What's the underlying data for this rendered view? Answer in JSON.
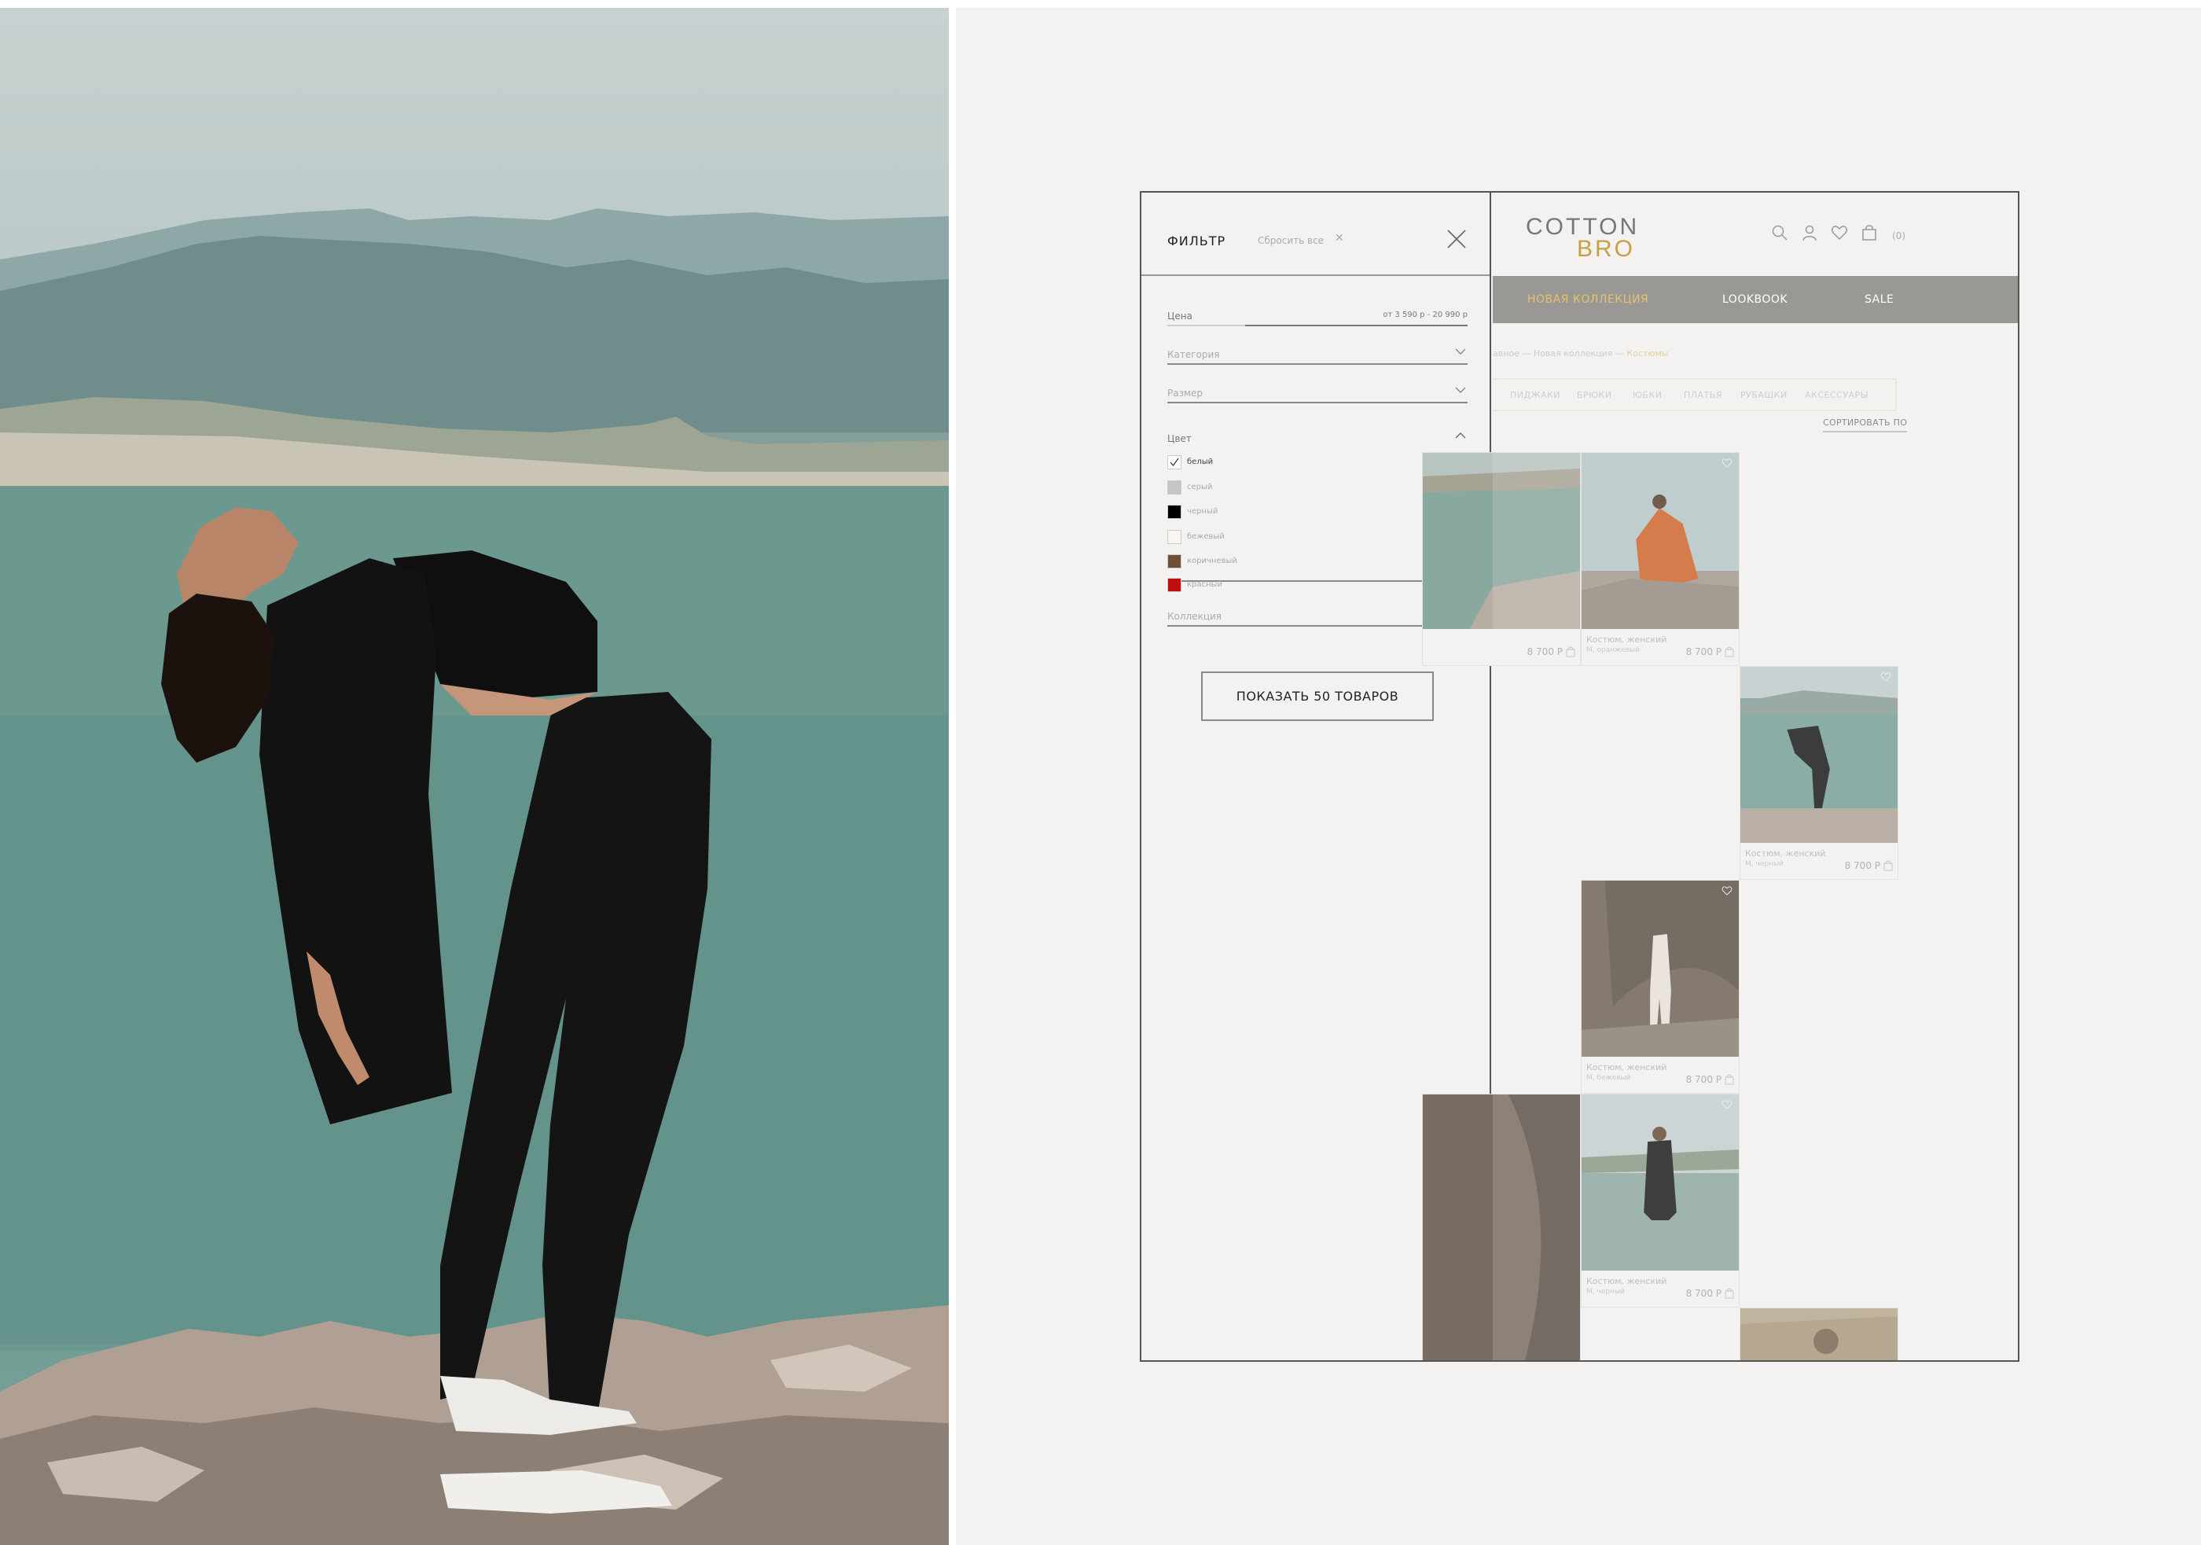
{
  "filter": {
    "title": "ФИЛЬТР",
    "reset_label": "Сбросить все",
    "reset_x": "✕",
    "price": {
      "label": "Цена",
      "range": "от 3 590 р - 20 990 р",
      "selected_fraction_from": 0.26,
      "selected_fraction_to": 1.0
    },
    "category_label": "Категория",
    "size_label": "Размер",
    "color_section": {
      "label": "Цвет",
      "options": [
        {
          "name": "белый",
          "color": "#ffffff",
          "checked": true
        },
        {
          "name": "серый",
          "color": "#c5c5c5",
          "checked": false
        },
        {
          "name": "черный",
          "color": "#000000",
          "checked": false
        },
        {
          "name": "бежевый",
          "color": "#f8f6ef",
          "checked": false
        },
        {
          "name": "коричневый",
          "color": "#6e4f37",
          "checked": false
        },
        {
          "name": "красный",
          "color": "#c00d0d",
          "checked": false
        }
      ]
    },
    "collection_label": "Коллекция",
    "show_button": "ПОКАЗАТЬ 50 ТОВАРОВ"
  },
  "header": {
    "logo_line1": "COTTON",
    "logo_line2": "BRO",
    "cart_count": "(0)",
    "nav": [
      "НОВАЯ КОЛЛЕКЦИЯ",
      "LOOKBOOK",
      "SALE"
    ],
    "nav_active_color": "#e7c06a"
  },
  "breadcrumbs": {
    "items": [
      "авное",
      "Новая коллекция"
    ],
    "current": "Костюмы",
    "separator": "—"
  },
  "categories": [
    "ПИДЖАКИ",
    "БРЮКИ",
    "ЮБКИ",
    "ПЛАТЬЯ",
    "РУБАШКИ",
    "АКСЕССУАРЫ"
  ],
  "sort_label": "СОРТИРОВАТЬ ПО",
  "products": [
    {
      "title": "",
      "meta": "",
      "price": "8 700 Р",
      "image": "lake-rocks"
    },
    {
      "title": "Костюм, женский",
      "meta": "М, оранжевый",
      "price": "8 700 Р",
      "image": "orange-suit"
    },
    {
      "title": "Костюм, женский",
      "meta": "М, черный",
      "price": "8 700 Р",
      "image": "black-suit-lake"
    },
    {
      "title": "Костюм, женский",
      "meta": "М, бежевый",
      "price": "8 700 Р",
      "image": "beige-suit-cave"
    },
    {
      "title": "Костюм, женский",
      "meta": "М, черный",
      "price": "8 700 Р",
      "image": "black-suit-water"
    }
  ],
  "colors": {
    "accent_gold": "#c8a043",
    "nav_bg": "#9a9895",
    "panel_bg": "#f3f2f0"
  }
}
